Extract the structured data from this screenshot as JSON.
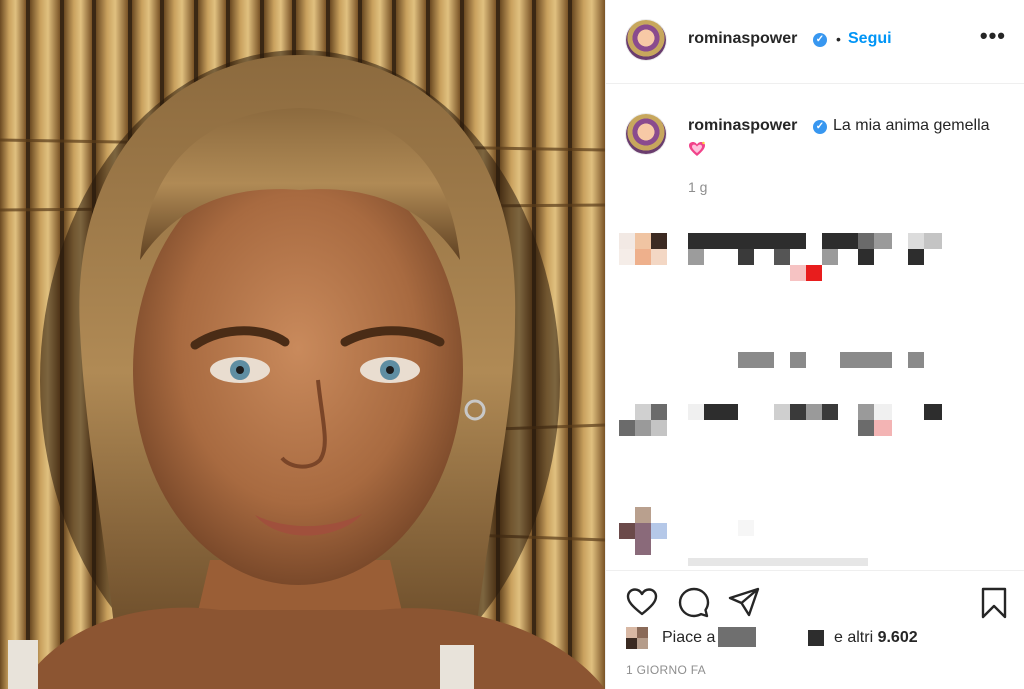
{
  "post": {
    "username": "rominaspower",
    "verified_mark": "✓",
    "separator": "•",
    "follow_label": "Segui",
    "more_label": "•••",
    "caption": {
      "username": "rominaspower",
      "text": "La mia anima gemella",
      "emoji": "sparkling-heart-emoji",
      "time": "1 g"
    },
    "likes": {
      "prefix": "Piace a",
      "suffix": "e altri",
      "count": "9.602"
    },
    "date": "1 GIORNO FA",
    "icons": {
      "like": "heart-outline-icon",
      "comment": "comment-bubble-icon",
      "share": "paper-plane-icon",
      "save": "bookmark-icon",
      "more": "ellipsis-icon"
    },
    "colors": {
      "accent": "#0095f6",
      "verified": "#3897f0",
      "text": "#262626",
      "muted": "#8e8e8e"
    }
  }
}
